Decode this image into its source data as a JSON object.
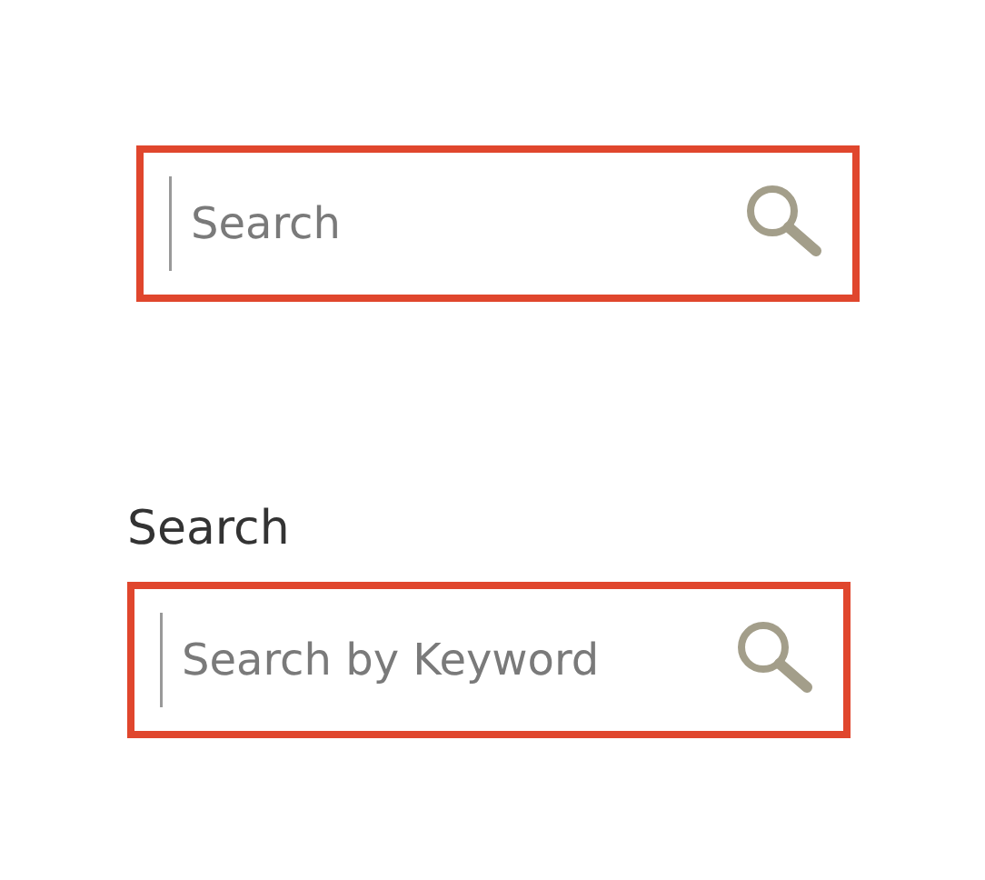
{
  "search_fields": [
    {
      "placeholder": "Search"
    },
    {
      "label": "Search",
      "placeholder": "Search by Keyword"
    }
  ]
}
